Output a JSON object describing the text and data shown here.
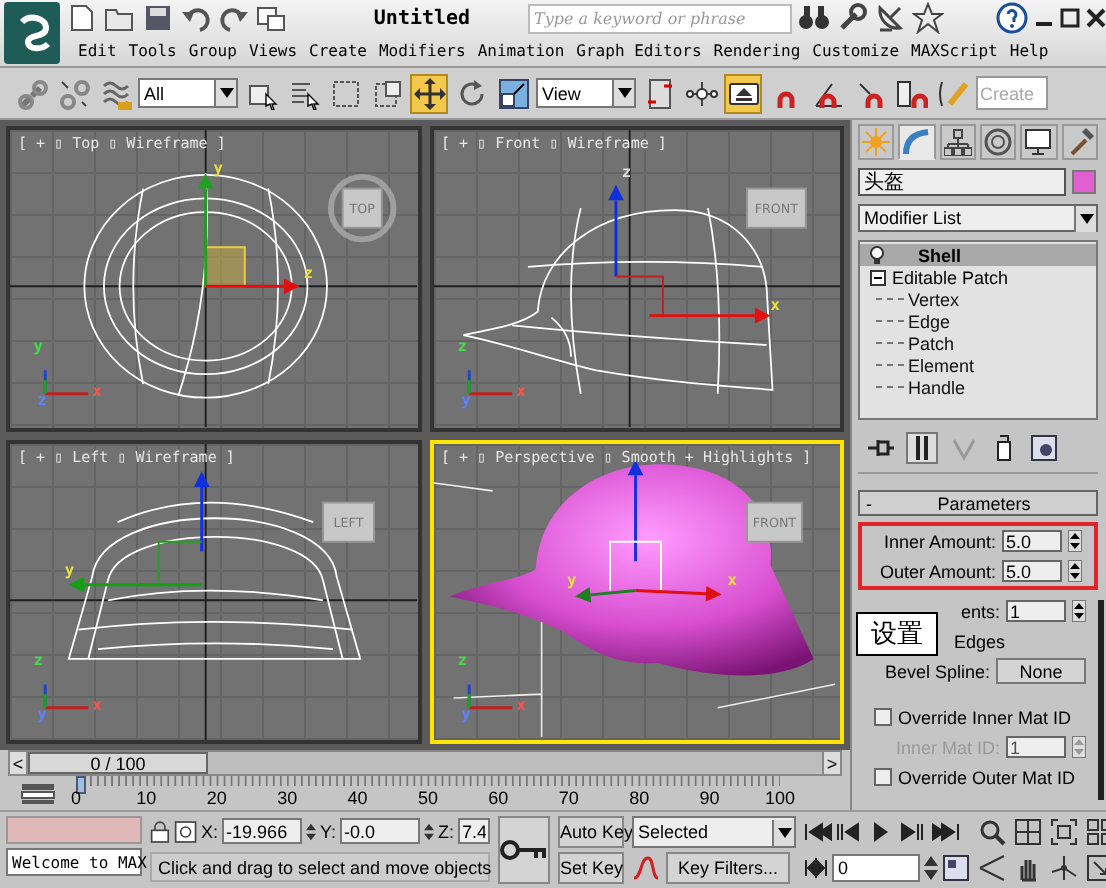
{
  "title_bar": {
    "title": "Untitled",
    "search": {
      "placeholder": "Type a keyword or phrase"
    }
  },
  "menu": [
    "Edit",
    "Tools",
    "Group",
    "Views",
    "Create",
    "Modifiers",
    "Animation",
    "Graph Editors",
    "Rendering",
    "Customize",
    "MAXScript",
    "Help"
  ],
  "toolbar": [
    {
      "kind": "tool",
      "selected": false
    },
    {
      "kind": "tool",
      "selected": false
    },
    {
      "kind": "tool",
      "selected": false
    },
    {
      "kind": "dropdown",
      "value": "All"
    },
    {
      "kind": "tool",
      "selected": false
    },
    {
      "kind": "tool",
      "selected": false
    },
    {
      "kind": "tool",
      "selected": false
    },
    {
      "kind": "tool",
      "selected": false
    },
    {
      "kind": "tool",
      "selected": true
    },
    {
      "kind": "tool",
      "selected": false
    },
    {
      "kind": "tool",
      "selected": false
    },
    {
      "kind": "dropdown",
      "value": "View"
    },
    {
      "kind": "tool",
      "selected": false
    },
    {
      "kind": "tool",
      "selected": false
    },
    {
      "kind": "tool",
      "selected": true
    },
    {
      "kind": "tool",
      "selected": false
    },
    {
      "kind": "tool",
      "selected": false
    },
    {
      "kind": "tool",
      "selected": false
    },
    {
      "kind": "tool",
      "selected": false
    },
    {
      "kind": "tool",
      "selected": false
    },
    {
      "kind": "field",
      "placeholder": "Create"
    }
  ],
  "viewports": [
    {
      "label": "[ + ▯ Top ▯ Wireframe ]",
      "cube": "TOP",
      "kind": "wireframe",
      "active": false,
      "gizmo_labels": [
        "y",
        "z"
      ],
      "tripod_labels": [
        "y",
        "z",
        "x"
      ]
    },
    {
      "label": "[ + ▯ Front ▯ Wireframe ]",
      "cube": "FRONT",
      "kind": "wireframe",
      "active": false,
      "gizmo_labels": [
        "z",
        "x"
      ],
      "tripod_labels": [
        "z",
        "y",
        "x"
      ]
    },
    {
      "label": "[ + ▯ Left ▯ Wireframe ]",
      "cube": "LEFT",
      "kind": "wireframe",
      "active": false,
      "gizmo_labels": [
        "y"
      ],
      "tripod_labels": [
        "z",
        "y",
        "x"
      ]
    },
    {
      "label": "[ + ▯ Perspective ▯ Smooth + Highlights ]",
      "cube": "FRONT",
      "kind": "shaded",
      "active": true,
      "gizmo_labels": [
        "y",
        "x"
      ],
      "tripod_labels": [
        "z",
        "y",
        "x"
      ]
    }
  ],
  "time_slider": {
    "prev": "<",
    "label": "0 / 100",
    "next": ">",
    "level": 0
  },
  "track_bar": {
    "ticks": [
      "0",
      "10",
      "20",
      "30",
      "40",
      "50",
      "60",
      "70",
      "80",
      "90",
      "100"
    ]
  },
  "command_panel": {
    "tabs": [
      {
        "selected": false
      },
      {
        "selected": true
      },
      {
        "selected": false
      },
      {
        "selected": false
      },
      {
        "selected": false
      },
      {
        "selected": false
      }
    ],
    "object": {
      "name": "头盔",
      "color": "#e060d0"
    },
    "modifier_list": "Modifier List",
    "stack": [
      {
        "label": "Shell",
        "selected": true
      },
      {
        "label": "Editable Patch",
        "selected": false,
        "expanded": true,
        "children": [
          {
            "label": "Vertex"
          },
          {
            "label": "Edge"
          },
          {
            "label": "Patch"
          },
          {
            "label": "Element"
          },
          {
            "label": "Handle"
          }
        ]
      }
    ],
    "rollout": {
      "toggle": "-",
      "title": "Parameters",
      "groups": [
        {
          "highlighted": true,
          "controls": [
            {
              "kind": "spinner",
              "label": "Inner Amount:",
              "value": "5.0",
              "disabled": false
            },
            {
              "kind": "spinner",
              "label": "Outer Amount:",
              "value": "5.0",
              "disabled": false
            }
          ]
        },
        {
          "highlighted": false,
          "controls": [
            {
              "kind": "spinner",
              "label": "ents:",
              "value": "1",
              "disabled": false
            },
            {
              "kind": "text",
              "label": "Edges"
            },
            {
              "kind": "button",
              "label": "Bevel Spline:",
              "value": "None"
            },
            {
              "kind": "checkbox",
              "label": "Override Inner Mat ID",
              "checked": false
            },
            {
              "kind": "spinner",
              "label": "Inner Mat ID:",
              "value": "1",
              "disabled": true
            },
            {
              "kind": "checkbox",
              "label": "Override Outer Mat ID",
              "checked": false
            }
          ]
        }
      ]
    },
    "callout": "设置"
  },
  "status": {
    "listener": "Welcome to MAX",
    "coords": [
      {
        "axis": "X:",
        "value": "-19.966"
      },
      {
        "axis": "Y:",
        "value": "-0.0"
      },
      {
        "axis": "Z:",
        "value": "7.4"
      }
    ],
    "prompt": "Click and drag to select and move objects"
  },
  "animation": {
    "auto_key": {
      "label": "Auto Key",
      "on": false
    },
    "set_key": "Set Key",
    "key_mode": "Selected",
    "key_filters": "Key Filters...",
    "current_frame": "0"
  }
}
